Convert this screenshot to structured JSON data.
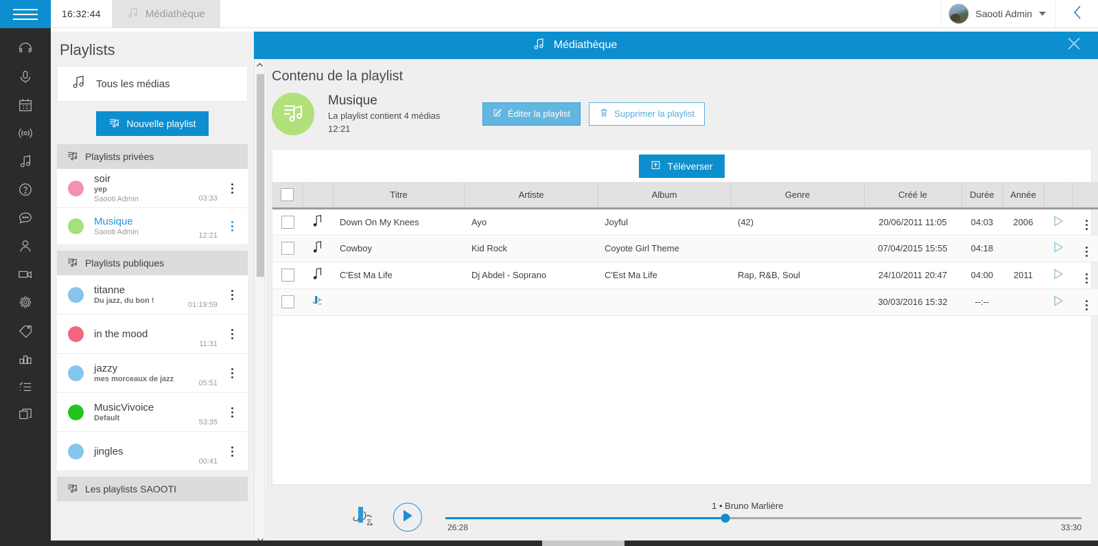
{
  "topbar": {
    "menu_icon": "hamburger-icon",
    "clock": "16:32:44",
    "tab_label": "Médiathèque",
    "tab_icon": "music-note-icon",
    "user_name": "Saooti Admin",
    "collapse_icon": "chevron-left-icon"
  },
  "rail": {
    "items": [
      {
        "icon": "headphones-icon",
        "name": "headphones"
      },
      {
        "icon": "microphone-icon",
        "name": "microphone"
      },
      {
        "icon": "calendar-icon",
        "name": "calendar"
      },
      {
        "icon": "broadcast-icon",
        "name": "broadcast"
      },
      {
        "icon": "music-note-icon",
        "name": "media-library"
      },
      {
        "icon": "question-circle-icon",
        "name": "help"
      },
      {
        "icon": "chat-bubble-icon",
        "name": "messages"
      },
      {
        "icon": "person-icon",
        "name": "participants"
      },
      {
        "icon": "video-camera-icon",
        "name": "video"
      },
      {
        "icon": "network-icon",
        "name": "network"
      },
      {
        "icon": "tag-icon",
        "name": "tags"
      },
      {
        "icon": "bar-chart-icon",
        "name": "statistics"
      },
      {
        "icon": "checklist-icon",
        "name": "checklist"
      },
      {
        "icon": "windows-icon",
        "name": "workspaces"
      }
    ]
  },
  "page_header": {
    "title": "Médiathèque",
    "icon": "music-note-icon",
    "close_icon": "close-icon",
    "accent_color": "#0d8ecf"
  },
  "playlist_panel": {
    "title": "Playlists",
    "all_media_label": "Tous les médias",
    "all_media_icon": "music-note-icon",
    "new_playlist_label": "Nouvelle playlist",
    "new_playlist_icon": "playlist-add-icon",
    "groups": [
      {
        "label": "Playlists privées",
        "icon": "playlist-icon",
        "items": [
          {
            "name": "soir",
            "subtitle": "yep",
            "owner": "Saooti Admin",
            "duration": "03:33",
            "color": "#f48fb6",
            "selected": false
          },
          {
            "name": "Musique",
            "subtitle": "",
            "owner": "Saooti Admin",
            "duration": "12:21",
            "color": "#a5e07c",
            "selected": true
          }
        ]
      },
      {
        "label": "Playlists publiques",
        "icon": "playlist-icon",
        "items": [
          {
            "name": "titanne",
            "subtitle": "Du jazz, du bon !",
            "owner": "",
            "duration": "01:19:59",
            "color": "#86c5ee",
            "selected": false
          },
          {
            "name": "in the mood",
            "subtitle": "",
            "owner": "",
            "duration": "11:31",
            "color": "#f4667f",
            "selected": false
          },
          {
            "name": "jazzy",
            "subtitle": "mes morceaux de jazz",
            "owner": "",
            "duration": "05:51",
            "color": "#86c5ee",
            "selected": false
          },
          {
            "name": "MusicVivoice",
            "subtitle": "Default",
            "owner": "",
            "duration": "53:35",
            "color": "#22c422",
            "selected": false
          },
          {
            "name": "jingles",
            "subtitle": "",
            "owner": "",
            "duration": "00:41",
            "color": "#86c5ee",
            "selected": false
          }
        ]
      },
      {
        "label": "Les playlists SAOOTI",
        "icon": "playlist-icon",
        "items": []
      }
    ]
  },
  "main": {
    "content_title": "Contenu de la playlist",
    "playlist": {
      "name": "Musique",
      "media_count_text": "La playlist contient 4 médias",
      "total_duration": "12:21",
      "avatar_color": "#b2e07a",
      "avatar_icon": "playlist-icon"
    },
    "actions": {
      "edit_label": "Éditer la playlist",
      "edit_icon": "edit-icon",
      "delete_label": "Supprimer la playlist",
      "delete_icon": "trash-icon"
    },
    "upload_label": "Téléverser",
    "upload_icon": "upload-icon",
    "table": {
      "columns": [
        "",
        "",
        "Titre",
        "Artiste",
        "Album",
        "Genre",
        "Créé le",
        "Durée",
        "Année",
        "",
        ""
      ],
      "rows": [
        {
          "icon": "music-note-icon",
          "title": "Down On My Knees",
          "artist": "Ayo",
          "album": "Joyful",
          "genre": "(42)",
          "created": "20/06/2011 11:05",
          "duration": "04:03",
          "year": "2006"
        },
        {
          "icon": "music-note-icon",
          "title": "Cowboy",
          "artist": "Kid Rock",
          "album": "Coyote Girl Theme",
          "genre": "",
          "created": "07/04/2015 15:55",
          "duration": "04:18",
          "year": ""
        },
        {
          "icon": "music-note-icon",
          "title": "C'Est Ma Life",
          "artist": "Dj Abdel - Soprano",
          "album": "C'Est Ma Life",
          "genre": "Rap, R&B, Soul",
          "created": "24/10/2011 20:47",
          "duration": "04:00",
          "year": "2011"
        },
        {
          "icon": "cafe-logo-icon",
          "title": "",
          "artist": "",
          "album": "",
          "genre": "",
          "created": "30/03/2016 15:32",
          "duration": "--:--",
          "year": ""
        }
      ]
    }
  },
  "player": {
    "logo_icon": "cafe-logo-icon",
    "play_icon": "play-icon",
    "track_label": "1 • Bruno Marlière",
    "current_time": "26:28",
    "total_time": "33:30",
    "progress_percent": 44,
    "accent_color": "#0d8ecf"
  }
}
